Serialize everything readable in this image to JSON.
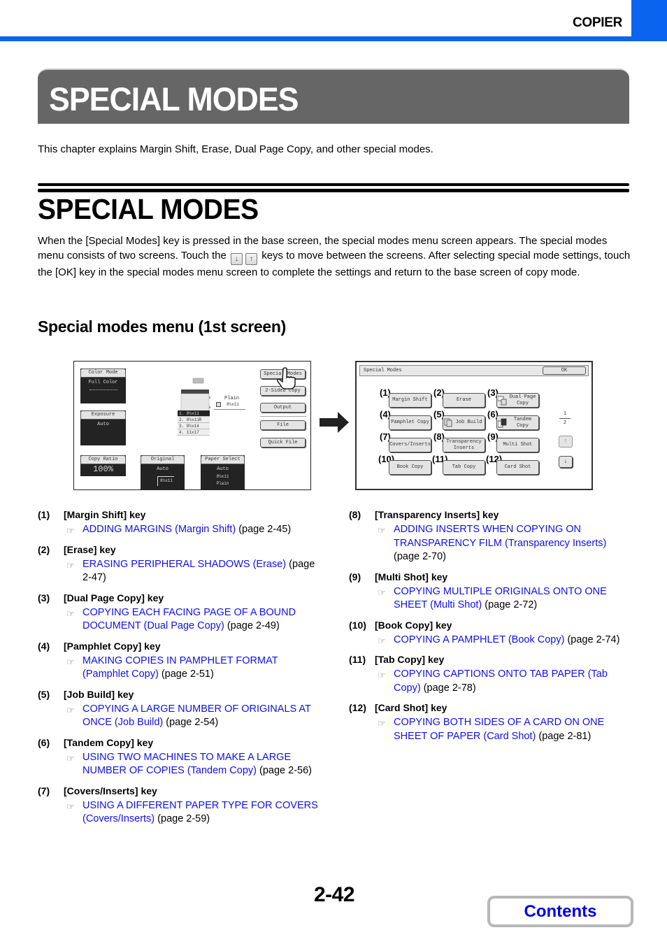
{
  "header": {
    "section_label": "COPIER",
    "accent_color": "#0a64f0"
  },
  "chapter": {
    "title": "SPECIAL MODES",
    "intro": "This chapter explains Margin Shift, Erase, Dual Page Copy, and other special modes."
  },
  "section": {
    "title": "SPECIAL MODES",
    "body_part1": "When the [Special Modes] key is pressed in the base screen, the special modes menu screen appears. The special modes menu consists of two screens. Touch the",
    "down_key_icon": "↓",
    "up_key_icon": "↑",
    "body_part2": "keys to move between the screens. After selecting special mode settings, touch the [OK] key in the special modes menu screen to complete the settings and return to the base screen of copy mode."
  },
  "subsection": {
    "title": "Special modes menu (1st screen)"
  },
  "base_screen": {
    "color_mode": {
      "label": "Color Mode",
      "value": "Full Color"
    },
    "exposure": {
      "label": "Exposure",
      "value": "Auto"
    },
    "copy_ratio": {
      "label": "Copy Ratio",
      "value": "100%"
    },
    "original": {
      "label": "Original",
      "value": "Auto",
      "size": "8½x11"
    },
    "paper_select": {
      "label": "Paper Select",
      "value": "Auto",
      "size": "8½x11",
      "type": "Plain"
    },
    "output_tray": {
      "type": "Plain",
      "size": "8½x11"
    },
    "trays": [
      "1. 8½x11",
      "2. 8½x11R",
      "3. 8½x14",
      "4. 11x17"
    ],
    "right_buttons": [
      "Special Modes",
      "2-Sided Copy",
      "Output",
      "File",
      "Quick File"
    ]
  },
  "special_modes_screen": {
    "title": "Special Modes",
    "ok_label": "OK",
    "page_current": "1",
    "page_total": "2",
    "up_icon": "↑",
    "down_icon": "↓",
    "keys": [
      {
        "num": "(1)",
        "label": "Margin Shift"
      },
      {
        "num": "(2)",
        "label": "Erase"
      },
      {
        "num": "(3)",
        "label": "Dual Page Copy"
      },
      {
        "num": "(4)",
        "label": "Pamphlet Copy"
      },
      {
        "num": "(5)",
        "label": "Job Build"
      },
      {
        "num": "(6)",
        "label": "Tandem Copy"
      },
      {
        "num": "(7)",
        "label": "Covers/Inserts"
      },
      {
        "num": "(8)",
        "label": "Transparency Inserts"
      },
      {
        "num": "(9)",
        "label": "Multi Shot"
      },
      {
        "num": "(10)",
        "label": "Book Copy"
      },
      {
        "num": "(11)",
        "label": "Tab Copy"
      },
      {
        "num": "(12)",
        "label": "Card Shot"
      }
    ]
  },
  "references": [
    {
      "num": "(1)",
      "title": "[Margin Shift] key",
      "link": "ADDING MARGINS (Margin Shift)",
      "page": "(page 2-45)"
    },
    {
      "num": "(2)",
      "title": "[Erase] key",
      "link": "ERASING PERIPHERAL SHADOWS (Erase)",
      "page": "(page 2-47)"
    },
    {
      "num": "(3)",
      "title": "[Dual Page Copy] key",
      "link": "COPYING EACH FACING PAGE OF A BOUND DOCUMENT (Dual Page Copy)",
      "page": "(page 2-49)"
    },
    {
      "num": "(4)",
      "title": "[Pamphlet Copy] key",
      "link": "MAKING COPIES IN PAMPHLET FORMAT (Pamphlet Copy)",
      "page": "(page 2-51)"
    },
    {
      "num": "(5)",
      "title": "[Job Build] key",
      "link": "COPYING A LARGE NUMBER OF ORIGINALS AT ONCE (Job Build)",
      "page": "(page 2-54)"
    },
    {
      "num": "(6)",
      "title": "[Tandem Copy] key",
      "link": "USING TWO MACHINES TO MAKE A LARGE NUMBER OF COPIES (Tandem Copy)",
      "page": "(page 2-56)"
    },
    {
      "num": "(7)",
      "title": "[Covers/Inserts] key",
      "link": "USING A DIFFERENT PAPER TYPE FOR COVERS (Covers/Inserts)",
      "page": "(page 2-59)"
    },
    {
      "num": "(8)",
      "title": "[Transparency Inserts] key",
      "link": "ADDING INSERTS WHEN COPYING ON TRANSPARENCY FILM (Transparency Inserts)",
      "page": "(page 2-70)"
    },
    {
      "num": "(9)",
      "title": "[Multi Shot] key",
      "link": "COPYING MULTIPLE ORIGINALS ONTO ONE SHEET (Multi Shot)",
      "page": "(page 2-72)"
    },
    {
      "num": "(10)",
      "title": "[Book Copy] key",
      "link": "COPYING A PAMPHLET (Book Copy)",
      "page": "(page 2-74)"
    },
    {
      "num": "(11)",
      "title": "[Tab Copy] key",
      "link": "COPYING CAPTIONS ONTO TAB PAPER (Tab Copy)",
      "page": "(page 2-78)"
    },
    {
      "num": "(12)",
      "title": "[Card Shot] key",
      "link": "COPYING BOTH SIDES OF A CARD ON ONE SHEET OF PAPER (Card Shot)",
      "page": "(page 2-81)"
    }
  ],
  "reference_icon": "☞",
  "footer": {
    "page_number": "2-42",
    "contents_label": "Contents"
  }
}
